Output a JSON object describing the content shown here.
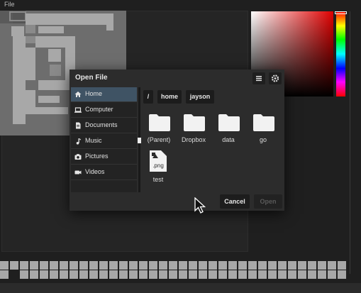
{
  "menubar": {
    "file_label": "File"
  },
  "dialog": {
    "title": "Open File",
    "sidebar": [
      {
        "label": "Home",
        "icon": "home-icon",
        "active": true
      },
      {
        "label": "Computer",
        "icon": "laptop-icon"
      },
      {
        "label": "Documents",
        "icon": "document-icon"
      },
      {
        "label": "Music",
        "icon": "music-icon"
      },
      {
        "label": "Pictures",
        "icon": "camera-icon"
      },
      {
        "label": "Videos",
        "icon": "video-icon"
      }
    ],
    "breadcrumbs": [
      "/",
      "home",
      "jayson"
    ],
    "entries": [
      {
        "label": "(Parent)",
        "icon": "folder-icon"
      },
      {
        "label": "Dropbox",
        "icon": "folder-icon"
      },
      {
        "label": "data",
        "icon": "folder-icon"
      },
      {
        "label": "go",
        "icon": "folder-icon"
      },
      {
        "label": "test",
        "icon": "image-file-icon",
        "ext": ".png"
      }
    ],
    "cancel_label": "Cancel",
    "open_label": "Open"
  },
  "colors": {
    "accent": "#3f5364",
    "dialog_bg": "#2c2c2c",
    "app_bg": "#1f1f1f"
  }
}
